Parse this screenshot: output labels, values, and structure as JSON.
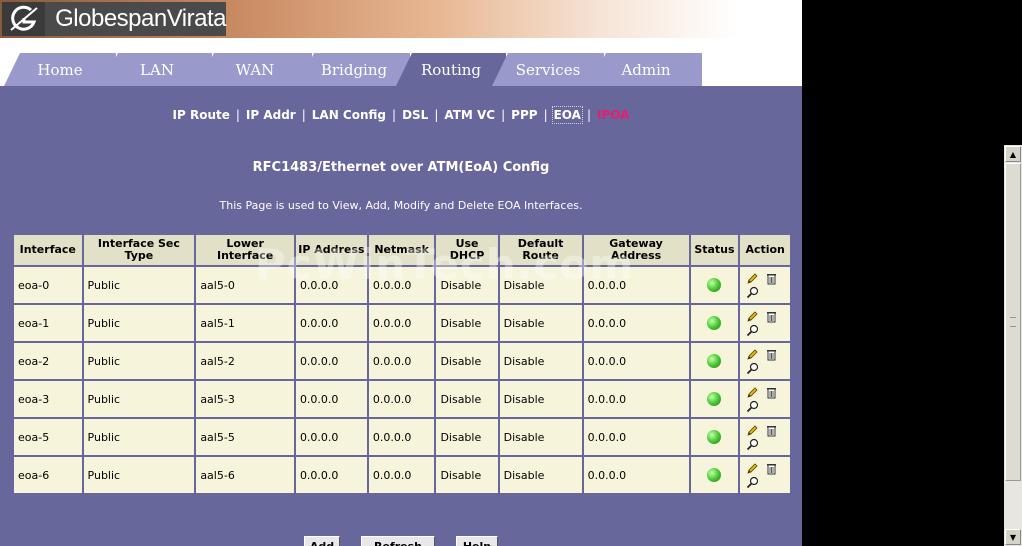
{
  "brand": {
    "name": "GlobespanVirata"
  },
  "tabs": [
    {
      "label": "Home",
      "active": false
    },
    {
      "label": "LAN",
      "active": false
    },
    {
      "label": "WAN",
      "active": false
    },
    {
      "label": "Bridging",
      "active": false
    },
    {
      "label": "Routing",
      "active": true
    },
    {
      "label": "Services",
      "active": false
    },
    {
      "label": "Admin",
      "active": false
    }
  ],
  "submenu": [
    {
      "label": "IP Route"
    },
    {
      "label": "IP Addr"
    },
    {
      "label": "LAN Config"
    },
    {
      "label": "DSL"
    },
    {
      "label": "ATM VC"
    },
    {
      "label": "PPP"
    },
    {
      "label": "EOA"
    },
    {
      "label": "IPOA"
    }
  ],
  "page": {
    "title": "RFC1483/Ethernet over ATM(EoA) Config",
    "description": "This Page is used to View, Add, Modify and Delete EOA Interfaces."
  },
  "watermark": "PcWinTech.com",
  "table": {
    "headers": [
      "Interface",
      "Interface Sec Type",
      "Lower Interface",
      "IP Address",
      "Netmask",
      "Use DHCP",
      "Default Route",
      "Gateway Address",
      "Status",
      "Action"
    ],
    "rows": [
      [
        "eoa-0",
        "Public",
        "aal5-0",
        "0.0.0.0",
        "0.0.0.0",
        "Disable",
        "Disable",
        "0.0.0.0"
      ],
      [
        "eoa-1",
        "Public",
        "aal5-1",
        "0.0.0.0",
        "0.0.0.0",
        "Disable",
        "Disable",
        "0.0.0.0"
      ],
      [
        "eoa-2",
        "Public",
        "aal5-2",
        "0.0.0.0",
        "0.0.0.0",
        "Disable",
        "Disable",
        "0.0.0.0"
      ],
      [
        "eoa-3",
        "Public",
        "aal5-3",
        "0.0.0.0",
        "0.0.0.0",
        "Disable",
        "Disable",
        "0.0.0.0"
      ],
      [
        "eoa-5",
        "Public",
        "aal5-5",
        "0.0.0.0",
        "0.0.0.0",
        "Disable",
        "Disable",
        "0.0.0.0"
      ],
      [
        "eoa-6",
        "Public",
        "aal5-6",
        "0.0.0.0",
        "0.0.0.0",
        "Disable",
        "Disable",
        "0.0.0.0"
      ]
    ]
  },
  "buttons": {
    "add": "Add",
    "refresh": "Refresh",
    "help": "Help"
  },
  "colors": {
    "panel": "#68679c",
    "tab": "#9a99cc",
    "active_link": "#e61e6e",
    "cell": "#f6f5dc",
    "header_cell": "#e2e0c6"
  }
}
